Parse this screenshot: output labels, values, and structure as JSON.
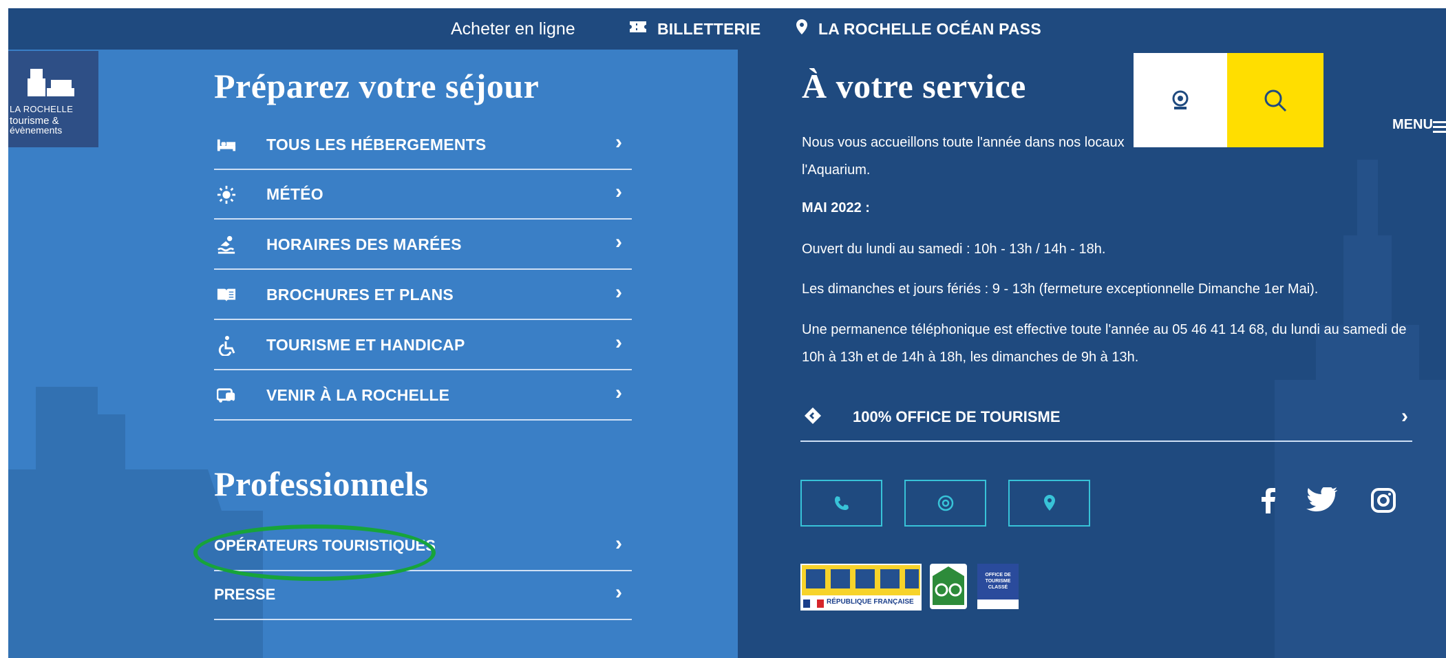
{
  "topbar": {
    "buy_label": "Acheter en ligne",
    "ticket_label": "BILLETTERIE",
    "pass_label": "LA ROCHELLE OCÉAN PASS"
  },
  "logo": {
    "name": "LA ROCHELLE",
    "sub1": "tourisme &",
    "sub2": "évènements"
  },
  "left": {
    "title": "Préparez votre séjour",
    "items": [
      {
        "label": "TOUS LES HÉBERGEMENTS",
        "icon": "bed-icon"
      },
      {
        "label": "MÉTÉO",
        "icon": "sun-icon"
      },
      {
        "label": "HORAIRES DES MARÉES",
        "icon": "swimmer-icon"
      },
      {
        "label": "BROCHURES ET PLANS",
        "icon": "book-icon"
      },
      {
        "label": "TOURISME ET HANDICAP",
        "icon": "wheelchair-icon"
      },
      {
        "label": "VENIR À LA ROCHELLE",
        "icon": "bus-icon"
      }
    ],
    "pro_title": "Professionnels",
    "pro_items": [
      {
        "label": "OPÉRATEURS TOURISTIQUES"
      },
      {
        "label": "PRESSE"
      }
    ],
    "chevron": "›"
  },
  "right": {
    "title": "À votre service",
    "p1a": "Nous vous accueillons toute l'année dans nos locaux",
    "p1b": "l'Aquarium.",
    "may": "MAI 2022 :",
    "hours1": "Ouvert du lundi au samedi : 10h - 13h / 14h - 18h.",
    "hours2": "Les dimanches et jours fériés : 9 - 13h (fermeture exceptionnelle Dimanche 1er Mai).",
    "phone1": "Une permanence téléphonique est effective toute l'année au 05 46 41 14 68, du lundi au samedi de",
    "phone2": "10h à 13h et de 14h à 18h, les dimanches de 9h à 13h.",
    "office_label": "100% OFFICE DE TOURISME",
    "chevron": "›"
  },
  "header": {
    "menu_label": "MENU"
  },
  "badges": {
    "rf_label": "RÉPUBLIQUE FRANÇAISE",
    "classe_label": "OFFICE DE TOURISME CLASSÉ"
  },
  "colors": {
    "left_bg": "#3a7fc6",
    "right_bg": "#1f4a7f",
    "accent_yellow": "#ffde00",
    "contact_cyan": "#38c3d8",
    "highlight_green": "#17a43a"
  }
}
